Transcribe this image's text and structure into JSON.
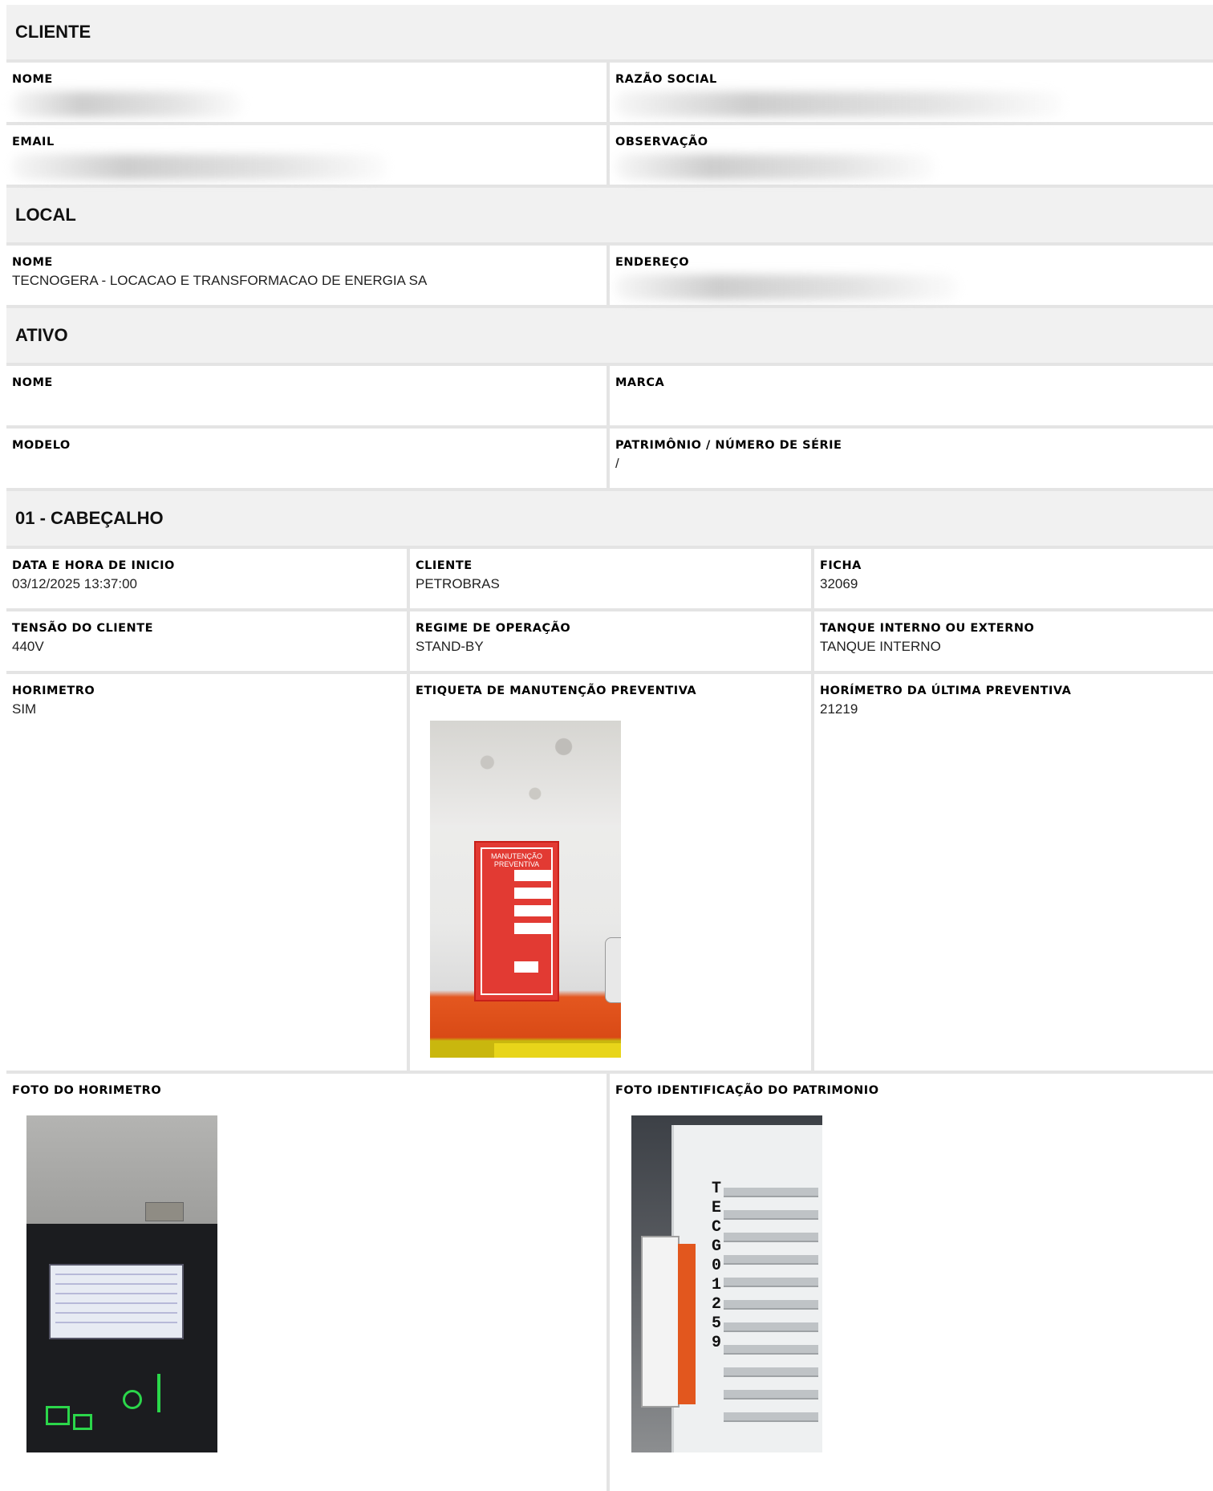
{
  "cliente": {
    "title": "CLIENTE",
    "nome_label": "NOME",
    "razao_social_label": "RAZÃO SOCIAL",
    "email_label": "EMAIL",
    "observacao_label": "OBSERVAÇÃO"
  },
  "local": {
    "title": "LOCAL",
    "nome_label": "NOME",
    "nome_value": "TECNOGERA - LOCACAO E TRANSFORMACAO DE ENERGIA SA",
    "endereco_label": "ENDEREÇO"
  },
  "ativo": {
    "title": "ATIVO",
    "nome_label": "NOME",
    "marca_label": "MARCA",
    "modelo_label": "MODELO",
    "patrimonio_label": "PATRIMÔNIO / NÚMERO DE SÉRIE",
    "patrimonio_value": "/"
  },
  "cabecalho": {
    "title": "01 - CABEÇALHO",
    "data_label": "DATA E HORA DE INICIO",
    "data_value": "03/12/2025 13:37:00",
    "cliente_label": "CLIENTE",
    "cliente_value": "PETROBRAS",
    "ficha_label": "FICHA",
    "ficha_value": "32069",
    "tensao_label": "TENSÃO DO CLIENTE",
    "tensao_value": "440V",
    "regime_label": "REGIME DE OPERAÇÃO",
    "regime_value": "STAND-BY",
    "tanque_label": "TANQUE INTERNO OU EXTERNO",
    "tanque_value": "TANQUE INTERNO",
    "horimetro_label": "HORIMETRO",
    "horimetro_value": "SIM",
    "etiqueta_label": "ETIQUETA DE MANUTENÇÃO PREVENTIVA",
    "ultima_label": "HORÍMETRO DA ÚLTIMA PREVENTIVA",
    "ultima_value": "21219",
    "foto_horimetro_label": "FOTO DO HORIMETRO",
    "foto_patrimonio_label": "FOTO IDENTIFICAÇÃO DO PATRIMONIO"
  },
  "photos": {
    "etiqueta_tag_title": "MANUTENÇÃO PREVENTIVA",
    "asset_code": "TECG01259"
  }
}
